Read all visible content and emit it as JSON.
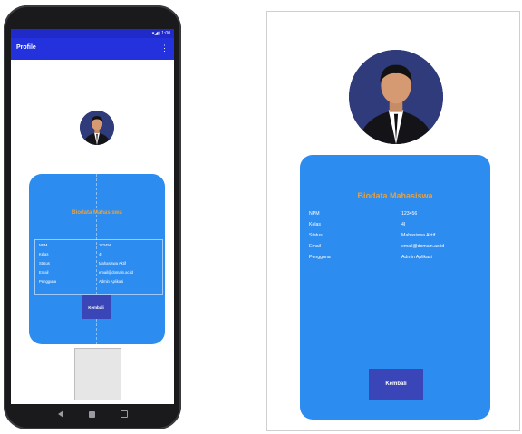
{
  "app": {
    "title": "Profile",
    "status_icons": "▾◢▮ 1:00"
  },
  "profile": {
    "heading": "Biodata Mahasiswa",
    "rows": [
      {
        "label": "NPM",
        "value": "123456"
      },
      {
        "label": "Kelas",
        "value": "4I"
      },
      {
        "label": "Status",
        "value": "Mahasiswa Aktif"
      },
      {
        "label": "Email",
        "value": "email@domain.ac.id"
      },
      {
        "label": "Pengguna",
        "value": "Admin Aplikasi"
      }
    ],
    "button_label": "Kembali"
  },
  "colors": {
    "appbar": "#2332dd",
    "card": "#2d8cf0",
    "heading_text": "#e8a13a",
    "button": "#3a46b8"
  }
}
